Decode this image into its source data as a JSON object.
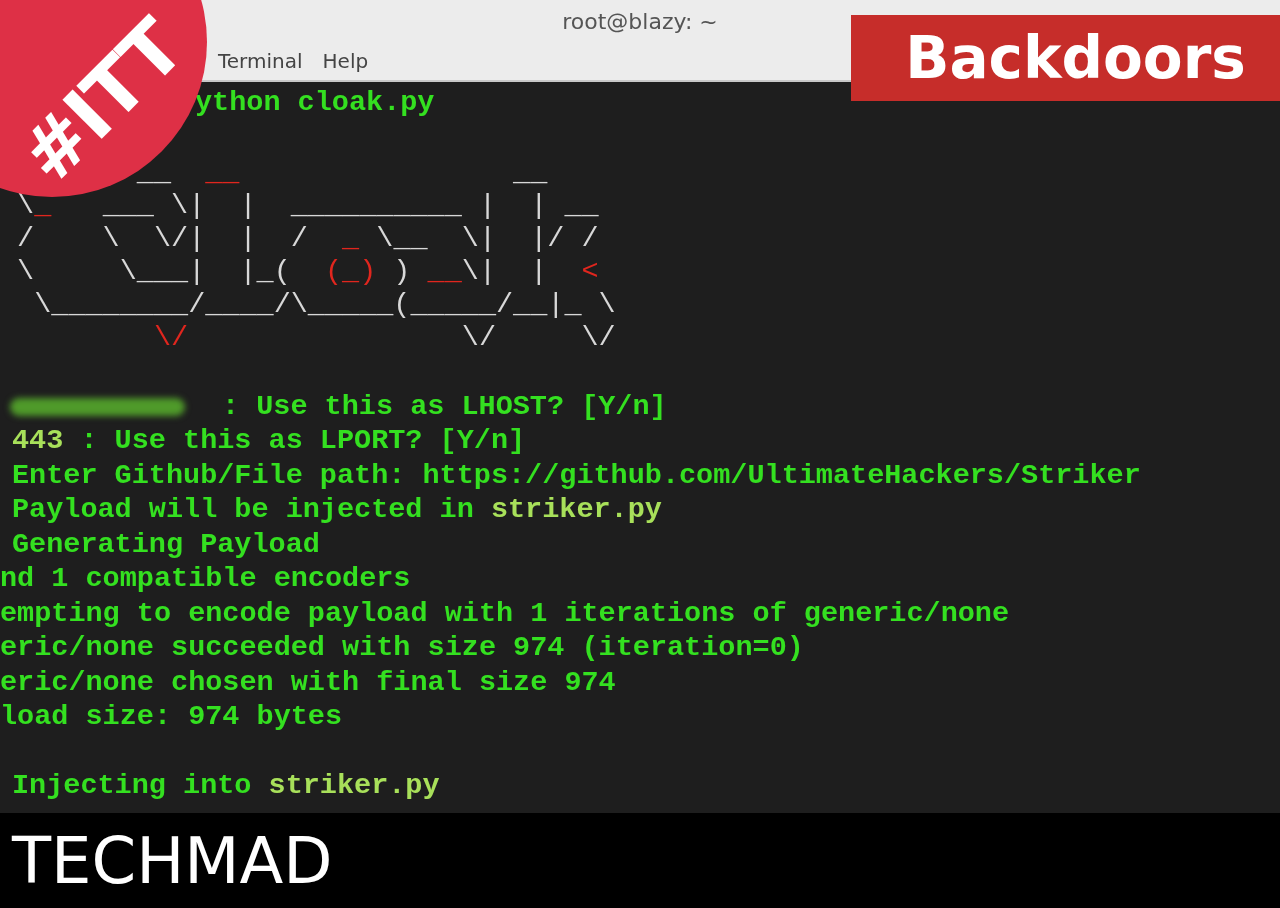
{
  "window": {
    "title": "root@blazy: ~"
  },
  "menu": [
    {
      "label": "Terminal"
    },
    {
      "label": "Help"
    }
  ],
  "badge": {
    "text": "#ITT"
  },
  "banner": {
    "text": "Backdoors"
  },
  "prompt": {
    "command": "ython cloak.py"
  },
  "ascii_logo": [
    [
      {
        "text": "        __  "
      },
      {
        "text": "__",
        "red": true
      },
      {
        "text": "                __"
      }
    ],
    [
      {
        "text": " \\"
      },
      {
        "text": "_",
        "red": true
      },
      {
        "text": "   ___ \\|  |  __________ |  | __"
      }
    ],
    [
      {
        "text": " /    \\  \\/|  |  /  "
      },
      {
        "text": "_",
        "red": true
      },
      {
        "text": " \\__  \\|  |/ /"
      }
    ],
    [
      {
        "text": " \\     \\___|  |_(  "
      },
      {
        "text": "(_)",
        "red": true
      },
      {
        "text": " ) "
      },
      {
        "text": "__",
        "red": true
      },
      {
        "text": "\\|  |  "
      },
      {
        "text": "<",
        "red": true
      }
    ],
    [
      {
        "text": "  \\________/____/\\_____(_____/__|_ \\"
      }
    ],
    [
      {
        "text": "         \\/",
        "red": true
      },
      {
        "text": "                \\/     \\/"
      }
    ]
  ],
  "output_lines": [
    {
      "indent": false,
      "redacted": true,
      "segments": [
        {
          "text": ": Use this as LHOST? [Y/n]",
          "kind": "normal"
        }
      ]
    },
    {
      "indent": true,
      "redacted": false,
      "segments": [
        {
          "text": "443",
          "kind": "highlight"
        },
        {
          "text": " : Use this as LPORT? [Y/n]",
          "kind": "normal"
        }
      ]
    },
    {
      "indent": true,
      "redacted": false,
      "segments": [
        {
          "text": "Enter Github/File path: https://github.com/UltimateHackers/Striker",
          "kind": "normal"
        }
      ]
    },
    {
      "indent": true,
      "redacted": false,
      "segments": [
        {
          "text": "Payload will be injected in ",
          "kind": "normal"
        },
        {
          "text": "striker.py",
          "kind": "highlight"
        }
      ]
    },
    {
      "indent": true,
      "redacted": false,
      "segments": [
        {
          "text": "Generating Payload",
          "kind": "normal"
        }
      ]
    },
    {
      "indent": false,
      "redacted": false,
      "segments": [
        {
          "text": "nd 1 compatible encoders",
          "kind": "normal"
        }
      ]
    },
    {
      "indent": false,
      "redacted": false,
      "segments": [
        {
          "text": "empting to encode payload with 1 iterations of generic/none",
          "kind": "normal"
        }
      ]
    },
    {
      "indent": false,
      "redacted": false,
      "segments": [
        {
          "text": "eric/none succeeded with size 974 (iteration=0)",
          "kind": "normal"
        }
      ]
    },
    {
      "indent": false,
      "redacted": false,
      "segments": [
        {
          "text": "eric/none chosen with final size 974",
          "kind": "normal"
        }
      ]
    },
    {
      "indent": false,
      "redacted": false,
      "segments": [
        {
          "text": "load size: 974 bytes",
          "kind": "normal"
        }
      ]
    }
  ],
  "injection_lines": [
    {
      "indent": true,
      "redacted": false,
      "segments": [
        {
          "text": "Injecting into ",
          "kind": "normal"
        },
        {
          "text": "striker.py",
          "kind": "highlight"
        }
      ]
    }
  ],
  "footer": {
    "text": "TECHMAD"
  }
}
